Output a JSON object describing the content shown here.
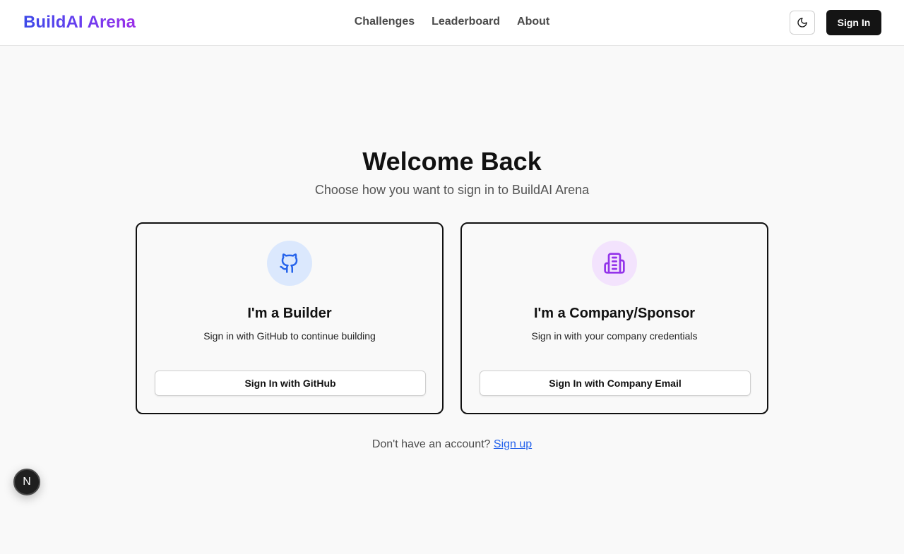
{
  "header": {
    "logo": "BuildAI Arena",
    "nav": [
      "Challenges",
      "Leaderboard",
      "About"
    ],
    "theme_icon": "moon-icon",
    "signin_label": "Sign In"
  },
  "main": {
    "title": "Welcome Back",
    "subtitle": "Choose how you want to sign in to BuildAI Arena",
    "cards": [
      {
        "icon": "github-icon",
        "title": "I'm a Builder",
        "description": "Sign in with GitHub to continue building",
        "button": "Sign In with GitHub",
        "accent": "#2563eb"
      },
      {
        "icon": "building-icon",
        "title": "I'm a Company/Sponsor",
        "description": "Sign in with your company credentials",
        "button": "Sign In with Company Email",
        "accent": "#9333ea"
      }
    ],
    "footer_prompt": "Don't have an account?",
    "footer_link": "Sign up"
  },
  "dev_badge": "N"
}
